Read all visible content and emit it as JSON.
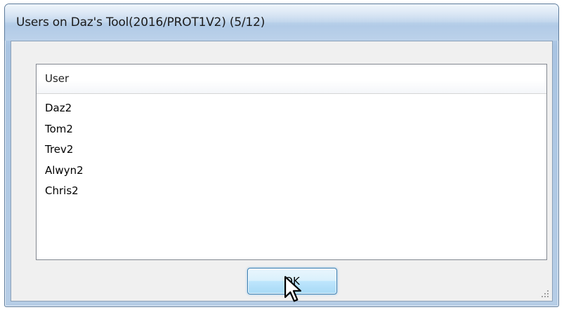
{
  "window": {
    "title": "Users on Daz's Tool(2016/PROT1V2) (5/12)"
  },
  "list": {
    "column_header": "User",
    "rows": [
      "Daz2",
      "Tom2",
      "Trev2",
      "Alwyn2",
      "Chris2"
    ]
  },
  "buttons": {
    "ok_label": "OK"
  },
  "icons": {
    "cursor": "arrow-pointer-icon",
    "grip": "resize-grip-icon"
  },
  "colors": {
    "titlebar": "#b9cfe8",
    "client_bg": "#f0f0f0",
    "button_border": "#3c7fb1"
  }
}
